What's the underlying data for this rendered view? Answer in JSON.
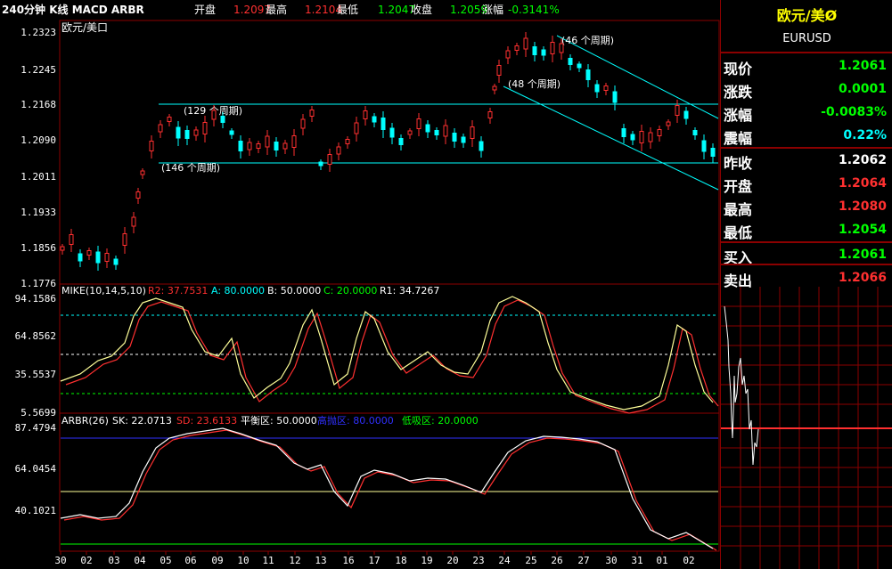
{
  "top": {
    "title": "240分钟 K线 MACD ARBR",
    "items": [
      {
        "label": "开盘",
        "value": "1.2097"
      },
      {
        "label": "最高",
        "value": "1.2104"
      },
      {
        "label": "最低",
        "value": "1.2047"
      },
      {
        "label": "收盘",
        "value": "1.2059"
      },
      {
        "label": "涨幅",
        "value": "-0.3141%"
      }
    ]
  },
  "main_panel": {
    "pair_label": "欧元/美口",
    "y_ticks": [
      "1.2323",
      "1.2245",
      "1.2168",
      "1.2090",
      "1.2011",
      "1.1933",
      "1.1856",
      "1.1776"
    ],
    "channel_labels": [
      "(129 个周期)",
      "(146 个周期)",
      "(46 个周期)",
      "(48 个周期)"
    ]
  },
  "mike_panel": {
    "header": [
      {
        "text": "MIKE(10,14,5,10)",
        "color": "#ffffff"
      },
      {
        "text": "R2: 37.7531",
        "color": "#ff3030"
      },
      {
        "text": "A: 80.0000",
        "color": "#00ffff"
      },
      {
        "text": "B: 50.0000",
        "color": "#ffffff"
      },
      {
        "text": "C: 20.0000",
        "color": "#00ff00"
      },
      {
        "text": "R1: 34.7267",
        "color": "#ffffff"
      }
    ],
    "y_ticks": [
      "94.1586",
      "64.8562",
      "35.5537",
      "5.5699"
    ]
  },
  "arbr_panel": {
    "header": [
      {
        "text": "ARBR(26)",
        "color": "#ffffff"
      },
      {
        "text": "SK: 22.0713",
        "color": "#ffffff"
      },
      {
        "text": "SD: 23.6133",
        "color": "#ff3030"
      },
      {
        "text": "平衡区: 50.0000",
        "color": "#ffffff"
      },
      {
        "text": "高抛区: 80.0000",
        "color": "#3030ff"
      },
      {
        "text": "低吸区: 20.0000",
        "color": "#00ff00"
      }
    ],
    "y_ticks": [
      "87.4794",
      "64.0454",
      "40.1021"
    ]
  },
  "x_ticks": [
    "30",
    "02",
    "03",
    "04",
    "05",
    "06",
    "09",
    "10",
    "11",
    "12",
    "13",
    "16",
    "17",
    "18",
    "19",
    "20",
    "23",
    "24",
    "25",
    "26",
    "27",
    "30",
    "31",
    "01",
    "02"
  ],
  "right_panel": {
    "title": "欧元/美Ø",
    "symbol": "EURUSD",
    "rows": [
      {
        "label": "现价",
        "value": "1.2061",
        "color": "#00ff00"
      },
      {
        "label": "涨跌",
        "value": "0.0001",
        "color": "#00ff00"
      },
      {
        "label": "涨幅",
        "value": "-0.0083%",
        "color": "#00ff00"
      },
      {
        "label": "震幅",
        "value": "0.22%",
        "color": "#00ffff"
      },
      {
        "label": "昨收",
        "value": "1.2062",
        "color": "#ffffff"
      },
      {
        "label": "开盘",
        "value": "1.2064",
        "color": "#ff3030"
      },
      {
        "label": "最高",
        "value": "1.2080",
        "color": "#ff3030"
      },
      {
        "label": "最低",
        "value": "1.2054",
        "color": "#00ff00"
      },
      {
        "label": "买入",
        "value": "1.2061",
        "color": "#00ff00"
      },
      {
        "label": "卖出",
        "value": "1.2066",
        "color": "#ff3030"
      }
    ]
  }
}
